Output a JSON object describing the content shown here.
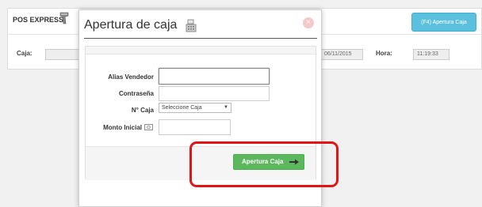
{
  "background": {
    "app_title": "POS EXPRESS",
    "f4_button_label": "(F4) Apertura Caja",
    "caja_label": "Caja:",
    "date_value": "06/11/2015",
    "hora_label": "Hora:",
    "hora_value": "11:19:33"
  },
  "modal": {
    "title": "Apertura de caja",
    "close_label": "×",
    "fields": {
      "alias_label": "Alias Vendedor",
      "alias_value": "",
      "password_label": "Contraseña",
      "password_value": "",
      "caja_label": "N° Caja",
      "caja_selected": "Seleccione Caja",
      "monto_label": "Monto Inicial",
      "monto_value": ""
    },
    "submit_label": "Apertura Caja"
  },
  "annotation": {
    "highlight_color": "#e01515"
  },
  "icons": [
    "scanner-icon",
    "cash-register-icon",
    "close-icon",
    "money-icon",
    "arrow-icon",
    "chevron-down-icon"
  ],
  "colors": {
    "f4_button": "#5bc0de",
    "submit_button": "#5cb85c",
    "close": "#f3c9c9"
  }
}
